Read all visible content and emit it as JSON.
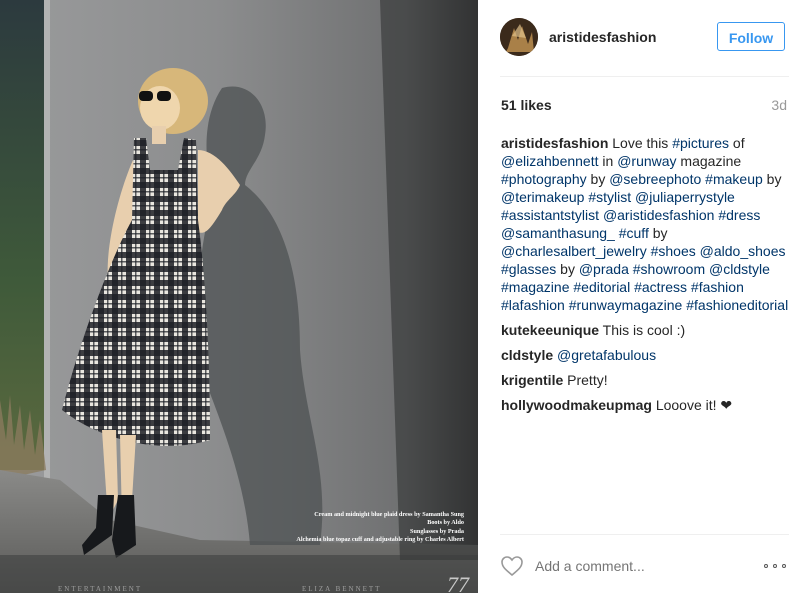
{
  "post": {
    "username": "aristidesfashion",
    "follow_label": "Follow",
    "likes": "51 likes",
    "age": "3d"
  },
  "photo": {
    "caption_lines": [
      "Cream and midnight blue plaid dress by Samantha Sung",
      "Boots by Aldo",
      "Sunglasses by Prada",
      "Alchemia blue topaz cuff and adjustable ring by Charles Albert"
    ],
    "footer_left": "ENTERTAINMENT",
    "footer_mid": "ELIZA BENNETT",
    "page_number": "77"
  },
  "caption": {
    "username": "aristidesfashion",
    "parts": [
      {
        "t": " Love this ",
        "link": false
      },
      {
        "t": "#pictures",
        "link": true
      },
      {
        "t": " of ",
        "link": false
      },
      {
        "t": "@elizahbennett",
        "link": true
      },
      {
        "t": " in ",
        "link": false
      },
      {
        "t": "@runway",
        "link": true
      },
      {
        "t": " magazine ",
        "link": false
      },
      {
        "t": "#photography",
        "link": true
      },
      {
        "t": " by ",
        "link": false
      },
      {
        "t": "@sebreephoto",
        "link": true
      },
      {
        "t": " ",
        "link": false
      },
      {
        "t": "#makeup",
        "link": true
      },
      {
        "t": " by ",
        "link": false
      },
      {
        "t": "@terimakeup",
        "link": true
      },
      {
        "t": " ",
        "link": false
      },
      {
        "t": "#stylist",
        "link": true
      },
      {
        "t": " ",
        "link": false
      },
      {
        "t": "@juliaperrystyle",
        "link": true
      },
      {
        "t": " ",
        "link": false
      },
      {
        "t": "#assistantstylist",
        "link": true
      },
      {
        "t": " ",
        "link": false
      },
      {
        "t": "@aristidesfashion",
        "link": true
      },
      {
        "t": " ",
        "link": false
      },
      {
        "t": "#dress",
        "link": true
      },
      {
        "t": " ",
        "link": false
      },
      {
        "t": "@samanthasung_",
        "link": true
      },
      {
        "t": " ",
        "link": false
      },
      {
        "t": "#cuff",
        "link": true
      },
      {
        "t": " by ",
        "link": false
      },
      {
        "t": "@charlesalbert_jewelry",
        "link": true
      },
      {
        "t": " ",
        "link": false
      },
      {
        "t": "#shoes",
        "link": true
      },
      {
        "t": " ",
        "link": false
      },
      {
        "t": "@aldo_shoes",
        "link": true
      },
      {
        "t": " ",
        "link": false
      },
      {
        "t": "#glasses",
        "link": true
      },
      {
        "t": " by ",
        "link": false
      },
      {
        "t": "@prada",
        "link": true
      },
      {
        "t": " ",
        "link": false
      },
      {
        "t": "#showroom",
        "link": true
      },
      {
        "t": " ",
        "link": false
      },
      {
        "t": "@cldstyle",
        "link": true
      },
      {
        "t": " ",
        "link": false
      },
      {
        "t": "#magazine",
        "link": true
      },
      {
        "t": " ",
        "link": false
      },
      {
        "t": "#editorial",
        "link": true
      },
      {
        "t": " ",
        "link": false
      },
      {
        "t": "#actress",
        "link": true
      },
      {
        "t": " ",
        "link": false
      },
      {
        "t": "#fashion",
        "link": true
      },
      {
        "t": " ",
        "link": false
      },
      {
        "t": "#lafashion",
        "link": true
      },
      {
        "t": " ",
        "link": false
      },
      {
        "t": "#runwaymagazine",
        "link": true
      },
      {
        "t": " ",
        "link": false
      },
      {
        "t": "#fashioneditorial",
        "link": true
      }
    ]
  },
  "comments": [
    {
      "username": "kutekeeunique",
      "parts": [
        {
          "t": " This is cool :)",
          "link": false
        }
      ]
    },
    {
      "username": "cldstyle",
      "parts": [
        {
          "t": " ",
          "link": false
        },
        {
          "t": "@gretafabulous",
          "link": true
        }
      ]
    },
    {
      "username": "krigentile",
      "parts": [
        {
          "t": " Pretty!",
          "link": false
        }
      ]
    },
    {
      "username": "hollywoodmakeupmag",
      "parts": [
        {
          "t": " Looove it! ❤",
          "link": false
        }
      ]
    }
  ],
  "footer": {
    "comment_placeholder": "Add a comment...",
    "heart_icon": "heart-outline-icon",
    "more_icon": "more-options-icon"
  },
  "colors": {
    "link": "#003569",
    "follow": "#3897f0",
    "muted": "#999999"
  }
}
